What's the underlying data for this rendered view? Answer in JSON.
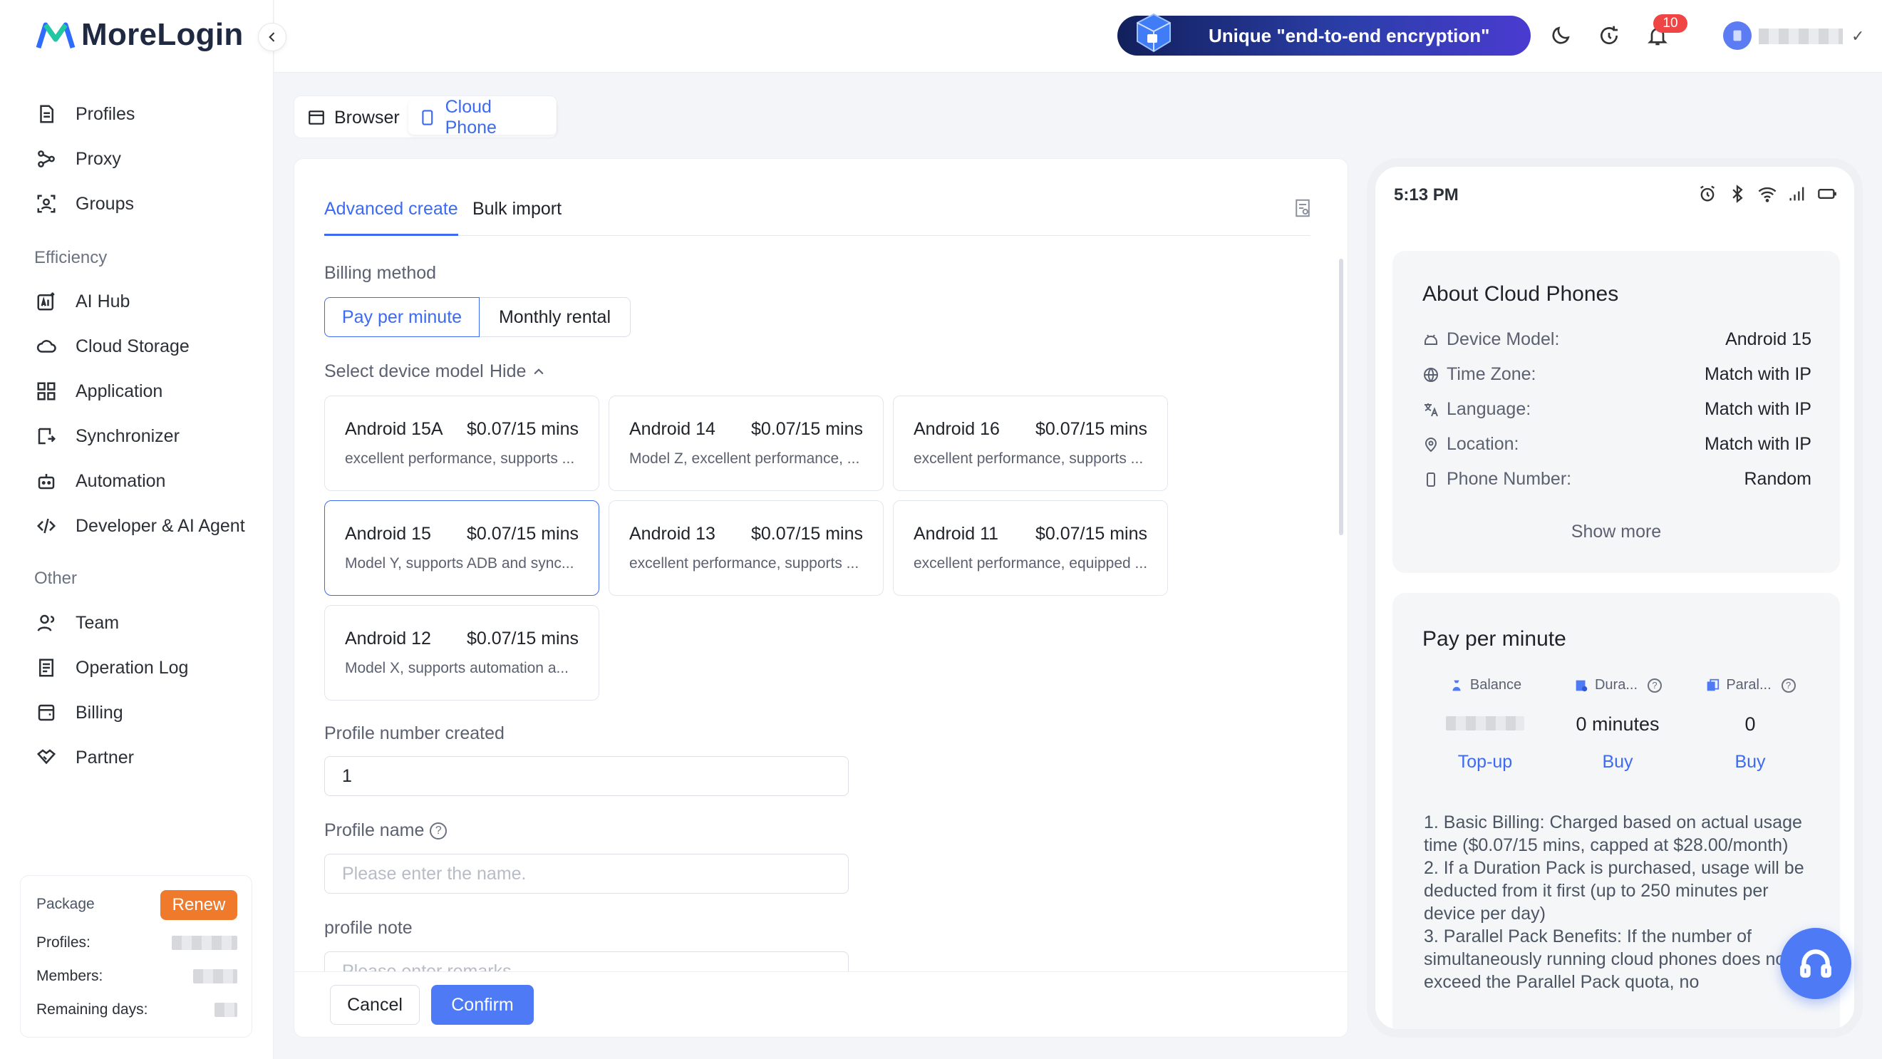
{
  "app": {
    "name": "MoreLogin"
  },
  "sidebar": {
    "items": [
      {
        "label": "Profiles",
        "icon": "profiles-icon"
      },
      {
        "label": "Proxy",
        "icon": "proxy-icon"
      },
      {
        "label": "Groups",
        "icon": "groups-icon"
      }
    ],
    "section_efficiency": "Efficiency",
    "efficiency_items": [
      {
        "label": "AI Hub",
        "icon": "ai-hub-icon"
      },
      {
        "label": "Cloud Storage",
        "icon": "cloud-icon"
      },
      {
        "label": "Application",
        "icon": "apps-icon"
      },
      {
        "label": "Synchronizer",
        "icon": "sync-icon"
      },
      {
        "label": "Automation",
        "icon": "robot-icon"
      },
      {
        "label": "Developer & AI Agent",
        "icon": "code-icon"
      }
    ],
    "section_other": "Other",
    "other_items": [
      {
        "label": "Team",
        "icon": "team-icon"
      },
      {
        "label": "Operation Log",
        "icon": "log-icon"
      },
      {
        "label": "Billing",
        "icon": "billing-icon"
      },
      {
        "label": "Partner",
        "icon": "handshake-icon"
      }
    ],
    "package": {
      "title": "Package",
      "renew": "Renew",
      "profiles_label": "Profiles:",
      "members_label": "Members:",
      "remaining_label": "Remaining days:"
    }
  },
  "topbar": {
    "promo_text": "Unique \"end-to-end encryption\"",
    "notification_count": "10"
  },
  "mode_tabs": {
    "browser": "Browser",
    "cloud_phone": "Cloud Phone"
  },
  "form": {
    "tabs": {
      "advanced": "Advanced create",
      "bulk": "Bulk import"
    },
    "billing_label": "Billing method",
    "billing_options": {
      "per_minute": "Pay per minute",
      "monthly": "Monthly rental"
    },
    "device_label": "Select device model",
    "hide": "Hide",
    "devices": [
      {
        "name": "Android 15A",
        "price": "$0.07/15 mins",
        "desc": "excellent performance, supports ..."
      },
      {
        "name": "Android 14",
        "price": "$0.07/15 mins",
        "desc": "Model Z, excellent performance, ..."
      },
      {
        "name": "Android 16",
        "price": "$0.07/15 mins",
        "desc": "excellent performance, supports ..."
      },
      {
        "name": "Android 15",
        "price": "$0.07/15 mins",
        "desc": "Model Y, supports ADB and sync..."
      },
      {
        "name": "Android 13",
        "price": "$0.07/15 mins",
        "desc": "excellent performance, supports ..."
      },
      {
        "name": "Android 11",
        "price": "$0.07/15 mins",
        "desc": "excellent performance, equipped ..."
      },
      {
        "name": "Android 12",
        "price": "$0.07/15 mins",
        "desc": "Model X, supports automation a..."
      }
    ],
    "profile_number_label": "Profile number created",
    "profile_number_value": "1",
    "profile_name_label": "Profile name",
    "profile_name_placeholder": "Please enter the name.",
    "profile_note_label": "profile note",
    "profile_note_placeholder": "Please enter remarks",
    "cancel": "Cancel",
    "confirm": "Confirm"
  },
  "phone": {
    "time": "5:13 PM",
    "about_title": "About Cloud Phones",
    "rows": [
      {
        "key": "Device Model:",
        "value": "Android 15"
      },
      {
        "key": "Time Zone:",
        "value": "Match with IP"
      },
      {
        "key": "Language:",
        "value": "Match with IP"
      },
      {
        "key": "Location:",
        "value": "Match with IP"
      },
      {
        "key": "Phone Number:",
        "value": "Random"
      }
    ],
    "show_more": "Show more",
    "pay_title": "Pay per minute",
    "stats": [
      {
        "head": "Balance",
        "value": "",
        "link": "Top-up"
      },
      {
        "head": "Dura...",
        "value": "0 minutes",
        "link": "Buy"
      },
      {
        "head": "Paral...",
        "value": "0",
        "link": "Buy"
      }
    ],
    "rules": "1. Basic Billing: Charged based on actual usage time ($0.07/15 mins, capped at $28.00/month)\n2. If a Duration Pack is purchased, usage will be deducted from it first (up to 250 minutes per device per day)\n3. Parallel Pack Benefits: If the number of simultaneously running cloud phones does not exceed the Parallel Pack quota, no"
  }
}
